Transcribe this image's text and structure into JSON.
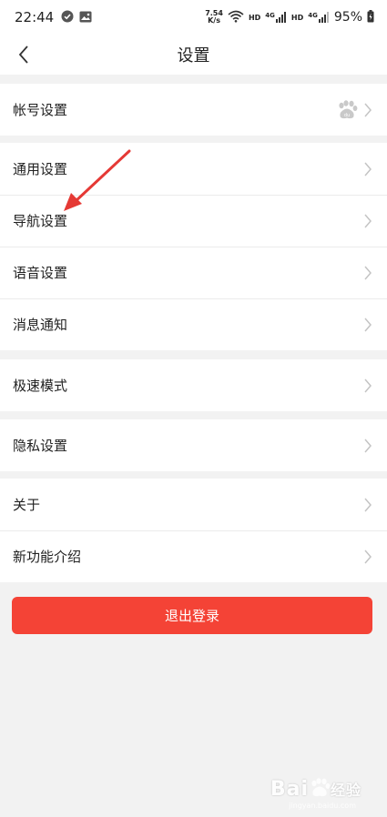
{
  "status_bar": {
    "time": "22:44",
    "net_speed_value": "7.54",
    "net_speed_unit": "K/s",
    "hd1": "HD",
    "net1": "4G",
    "hd2": "HD",
    "net2": "4G",
    "battery": "95%"
  },
  "nav": {
    "title": "设置"
  },
  "groups": [
    {
      "items": [
        {
          "label": "帐号设置",
          "icon": "baidu-paw-icon"
        }
      ]
    },
    {
      "items": [
        {
          "label": "通用设置"
        },
        {
          "label": "导航设置"
        },
        {
          "label": "语音设置"
        },
        {
          "label": "消息通知"
        }
      ]
    },
    {
      "items": [
        {
          "label": "极速模式"
        }
      ]
    },
    {
      "items": [
        {
          "label": "隐私设置"
        }
      ]
    },
    {
      "items": [
        {
          "label": "关于"
        },
        {
          "label": "新功能介绍"
        }
      ]
    }
  ],
  "logout_label": "退出登录",
  "watermark": {
    "brand": "Bai",
    "brand2": "经验",
    "sub": "jingyan.baidu.com"
  },
  "colors": {
    "accent": "#f44336",
    "arrow": "#e53935",
    "background": "#f2f2f2"
  }
}
